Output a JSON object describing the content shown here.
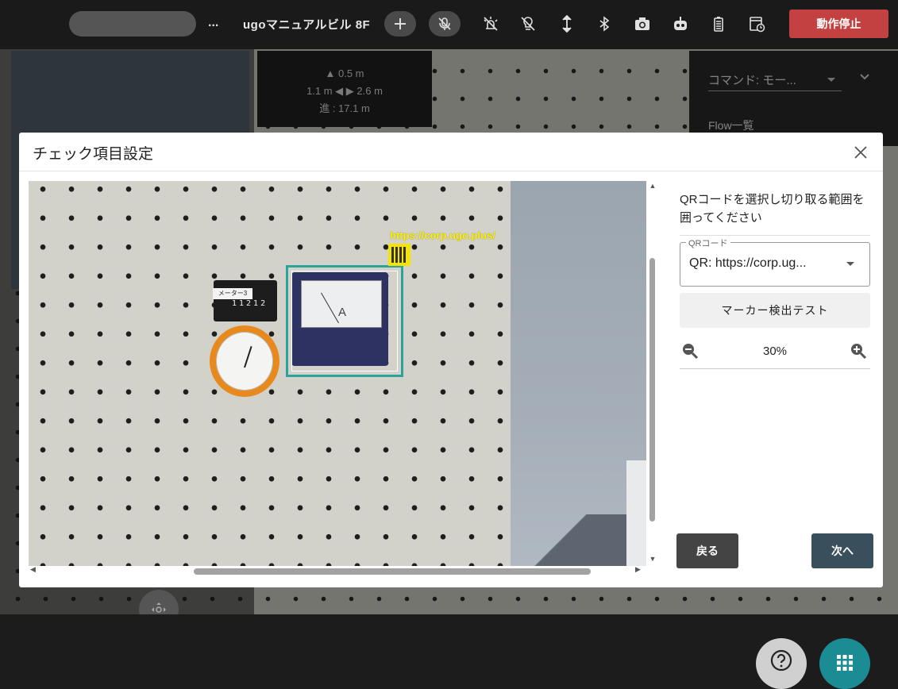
{
  "topbar": {
    "ellipsis": "...",
    "robot_name": "ugoマニュアルビル 8F",
    "stop_label": "動作停止",
    "stop_color": "#c44141"
  },
  "background": {
    "distance": {
      "up": "▲ 0.5 m",
      "sides": "1.1 m ◀ ▶ 2.6 m",
      "forward": "進 : 17.1 m"
    },
    "command_label": "コマンド: モー...",
    "flow_label": "Flow一覧"
  },
  "dialog": {
    "title": "チェック項目設定",
    "image": {
      "qr_text": "https://corp.ugo.plus/",
      "counter_label": "メーター3",
      "counter_digits": "11212",
      "ammeter_label": "A"
    },
    "side": {
      "instruction": "QRコードを選択し切り取る範囲を囲ってください",
      "qr_legend": "QRコード",
      "qr_value": "QR: https://corp.ug...",
      "marker_test_label": "マーカー検出テスト",
      "zoom_value": "30%",
      "back_label": "戻る",
      "next_label": "次へ"
    }
  },
  "colors": {
    "selection_box": "#2aa39b",
    "next_button": "#3a4f5c",
    "back_button": "#444444",
    "fab_grid": "#1b8c93"
  },
  "icons": [
    "add-icon",
    "mic-off-icon",
    "light-off-icon",
    "lightbulb-off-icon",
    "updown-arrow-icon",
    "bluetooth-icon",
    "camera-icon",
    "robot-icon",
    "battery-icon",
    "history-icon",
    "close-icon",
    "zoom-out-icon",
    "zoom-in-icon",
    "help-icon",
    "grid-icon",
    "move-icon",
    "dropdown-caret-icon"
  ]
}
